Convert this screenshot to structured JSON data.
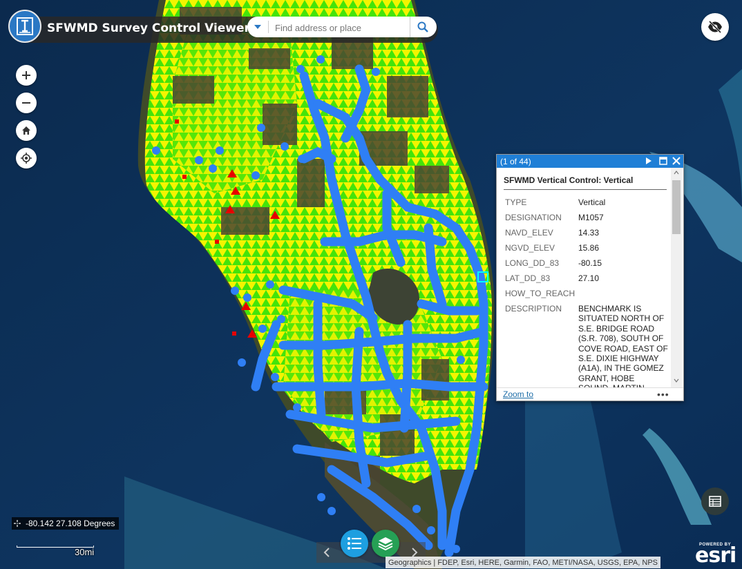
{
  "header": {
    "title": "SFWMD Survey Control Viewer",
    "search_placeholder": "Find address or place",
    "logo_icon": "benchmark-logo-icon"
  },
  "map_controls": {
    "zoom_in": "zoom-in-icon",
    "zoom_out": "zoom-out-icon",
    "home": "home-icon",
    "locate": "locate-icon",
    "visibility_toggle": "eye-slash-icon"
  },
  "popup": {
    "count": "(1 of 44)",
    "title": "SFWMD Vertical Control: Vertical",
    "attributes": [
      {
        "name": "TYPE",
        "value": "Vertical"
      },
      {
        "name": "DESIGNATION",
        "value": "M1057"
      },
      {
        "name": "NAVD_ELEV",
        "value": "14.33"
      },
      {
        "name": "NGVD_ELEV",
        "value": "15.86"
      },
      {
        "name": "LONG_DD_83",
        "value": "-80.15"
      },
      {
        "name": "LAT_DD_83",
        "value": "27.10"
      },
      {
        "name": "HOW_TO_REACH",
        "value": ""
      },
      {
        "name": "DESCRIPTION",
        "value": "BENCHMARK IS SITUATED NORTH OF S.E. BRIDGE ROAD (S.R. 708), SOUTH OF COVE ROAD, EAST OF S.E. DIXIE HIGHWAY (A1A), IN THE GOMEZ GRANT, HOBE SOUND, MARTIN"
      }
    ],
    "zoom_link": "Zoom to",
    "more": "•••"
  },
  "coordinates": "-80.142 27.108 Degrees",
  "scale_label": "30mi",
  "attribution": "Geographics | FDEP, Esri, HERE, Garmin, FAO, METI/NASA, USGS, EPA, NPS",
  "esri": {
    "powered_by": "POWERED BY",
    "brand": "esri"
  },
  "colors": {
    "accent": "#1f7fd6",
    "points_vertical": "#2f7ff5",
    "coverage_green": "#44e40a",
    "coverage_yellow": "#f4f400",
    "points_red": "#e80000",
    "legend_button": "#1e9fe0",
    "layers_button": "#26a055"
  }
}
